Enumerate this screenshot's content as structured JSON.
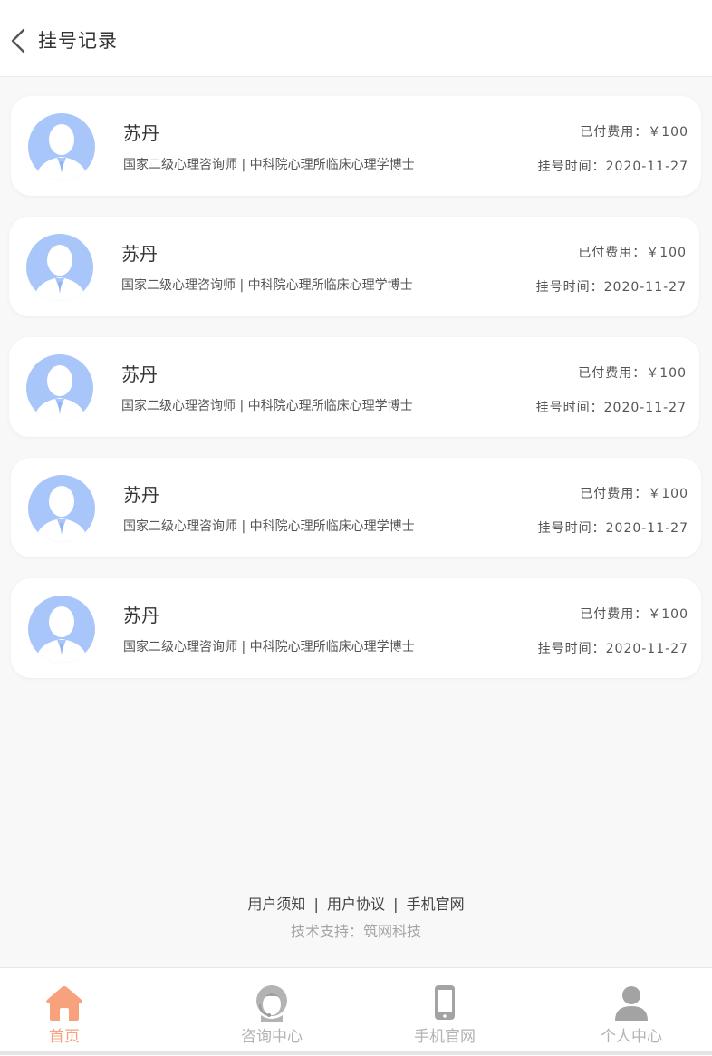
{
  "header": {
    "title": "挂号记录",
    "back_icon": "chevron-left-icon"
  },
  "records": [
    {
      "name": "苏丹",
      "desc": "国家二级心理咨询师 | 中科院心理所临床心理学博士",
      "fee": "已付费用：￥100",
      "time": "挂号时间：2020-11-27"
    },
    {
      "name": "苏丹",
      "desc": "国家二级心理咨询师 | 中科院心理所临床心理学博士",
      "fee": "已付费用：￥100",
      "time": "挂号时间：2020-11-27"
    },
    {
      "name": "苏丹",
      "desc": "国家二级心理咨询师 | 中科院心理所临床心理学博士",
      "fee": "已付费用：￥100",
      "time": "挂号时间：2020-11-27"
    },
    {
      "name": "苏丹",
      "desc": "国家二级心理咨询师 | 中科院心理所临床心理学博士",
      "fee": "已付费用：￥100",
      "time": "挂号时间：2020-11-27"
    },
    {
      "name": "苏丹",
      "desc": "国家二级心理咨询师 | 中科院心理所临床心理学博士",
      "fee": "已付费用：￥100",
      "time": "挂号时间：2020-11-27"
    }
  ],
  "footer": {
    "links": [
      "用户须知",
      "用户协议",
      "手机官网"
    ],
    "separator": "|",
    "support": "技术支持：筑网科技"
  },
  "tabbar": {
    "tabs": [
      {
        "label": "首页",
        "icon": "home-icon",
        "active": true
      },
      {
        "label": "咨询中心",
        "icon": "consultant-icon",
        "active": false
      },
      {
        "label": "手机官网",
        "icon": "mobile-phone-icon",
        "active": false
      },
      {
        "label": "个人中心",
        "icon": "person-icon",
        "active": false
      }
    ]
  },
  "colors": {
    "accent": "#f7a17d",
    "avatar": "#a9c6fb",
    "tab_inactive": "#b3b3b3"
  }
}
